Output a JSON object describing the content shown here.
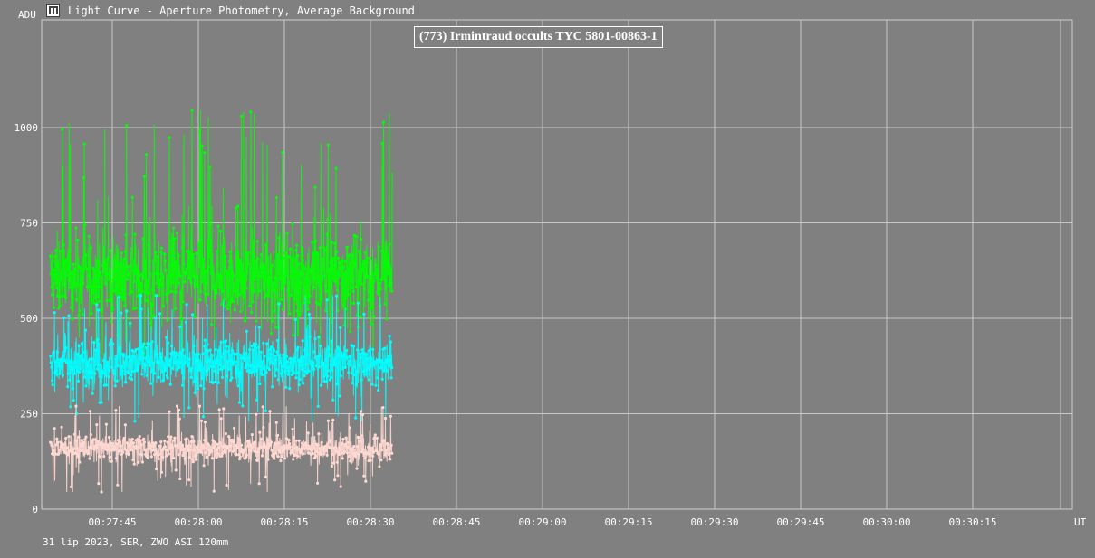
{
  "window": {
    "title": "Light Curve - Aperture Photometry, Average Background",
    "icon": "light-curve-app-icon"
  },
  "footer": {
    "text": "31 lip 2023, SER, ZWO ASI 120mm"
  },
  "chart_data": {
    "type": "scatter",
    "title": "(773) Irmintraud occults TYC 5801-00863-1",
    "ylabel": "ADU",
    "xlabel": "UT",
    "ylim": [
      0,
      1000
    ],
    "yticks": [
      {
        "value": 0,
        "label": "0"
      },
      {
        "value": 250,
        "label": "250"
      },
      {
        "value": 500,
        "label": "500"
      },
      {
        "value": 750,
        "label": "750"
      },
      {
        "value": 1000,
        "label": "1000"
      }
    ],
    "xrange_seconds": [
      1654,
      1714
    ],
    "xticks": [
      {
        "t": 1665,
        "label": "00:27:45"
      },
      {
        "t": 1680,
        "label": "00:28:00"
      },
      {
        "t": 1695,
        "label": "00:28:15"
      },
      {
        "t": 1710,
        "label": "00:28:30"
      },
      {
        "t": 1725,
        "label": "00:28:45"
      },
      {
        "t": 1740,
        "label": "00:29:00"
      },
      {
        "t": 1755,
        "label": "00:29:15"
      },
      {
        "t": 1770,
        "label": "00:29:30"
      },
      {
        "t": 1785,
        "label": "00:29:45"
      },
      {
        "t": 1800,
        "label": "00:30:00"
      },
      {
        "t": 1815,
        "label": "00:30:15"
      }
    ],
    "grid": true,
    "series": [
      {
        "color": "#00ff00",
        "mean": 610,
        "spread": 95,
        "spike_max": 1045,
        "min": 380
      },
      {
        "color": "#00ffff",
        "mean": 385,
        "spread": 55,
        "spike_max": 560,
        "min": 230
      },
      {
        "color": "#ffd8d2",
        "mean": 160,
        "spread": 30,
        "spike_max": 270,
        "min": 45
      }
    ]
  }
}
